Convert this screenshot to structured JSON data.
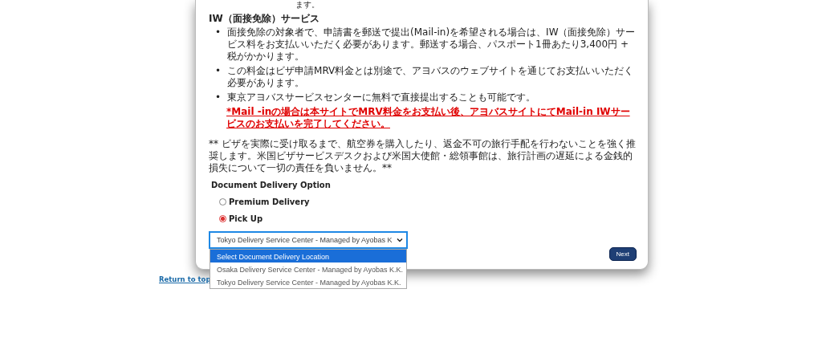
{
  "top_fragment": "ます。",
  "iw_section": {
    "heading": "IW（面接免除）サービス",
    "bullets": [
      {
        "marker": "•",
        "text": "面接免除の対象者で、申請書を郵送で提出(Mail-in)を希望される場合は、IW（面接免除）サービス料をお支払いいただく必要があります。郵送する場合、パスポート1冊あたり3,400円 + 税がかかります。"
      },
      {
        "marker": "•",
        "text": "この料金はビザ申請MRV料金とは別途で、アヨバスのウェブサイトを通じてお支払いいただく必要があります。"
      },
      {
        "marker": "•",
        "text": "東京アヨバスサービスセンターに無料で直接提出することも可能です。"
      }
    ],
    "warning": "*Mail -inの場合は本サイトでMRV料金をお支払い後、アヨバスサイトにてMail-in IWサービスのお支払いを完了してください。"
  },
  "notice": "** ビザを実際に受け取るまで、航空券を購入したり、返金不可の旅行手配を行わないことを強く推奨します。米国ビザサービスデスクおよび米国大使館・総領事館は、旅行計画の遅延による金銭的損失について一切の責任を負いません。**",
  "delivery": {
    "heading": "Document Delivery Option",
    "options": [
      {
        "label": "Premium Delivery",
        "selected": false
      },
      {
        "label": "Pick Up",
        "selected": true
      }
    ],
    "location_select": {
      "value": "Tokyo Delivery Service Center - Managed by Ayobas K",
      "expanded": true,
      "options": [
        {
          "label": "Select Document Delivery Location",
          "highlighted": true
        },
        {
          "label": "Osaka Delivery Service Center - Managed by Ayobas K.K.",
          "highlighted": false
        },
        {
          "label": "Tokyo Delivery Service Center - Managed by Ayobas K.K.",
          "highlighted": false
        }
      ]
    }
  },
  "next_button": "Next",
  "return_link": "Return to top"
}
